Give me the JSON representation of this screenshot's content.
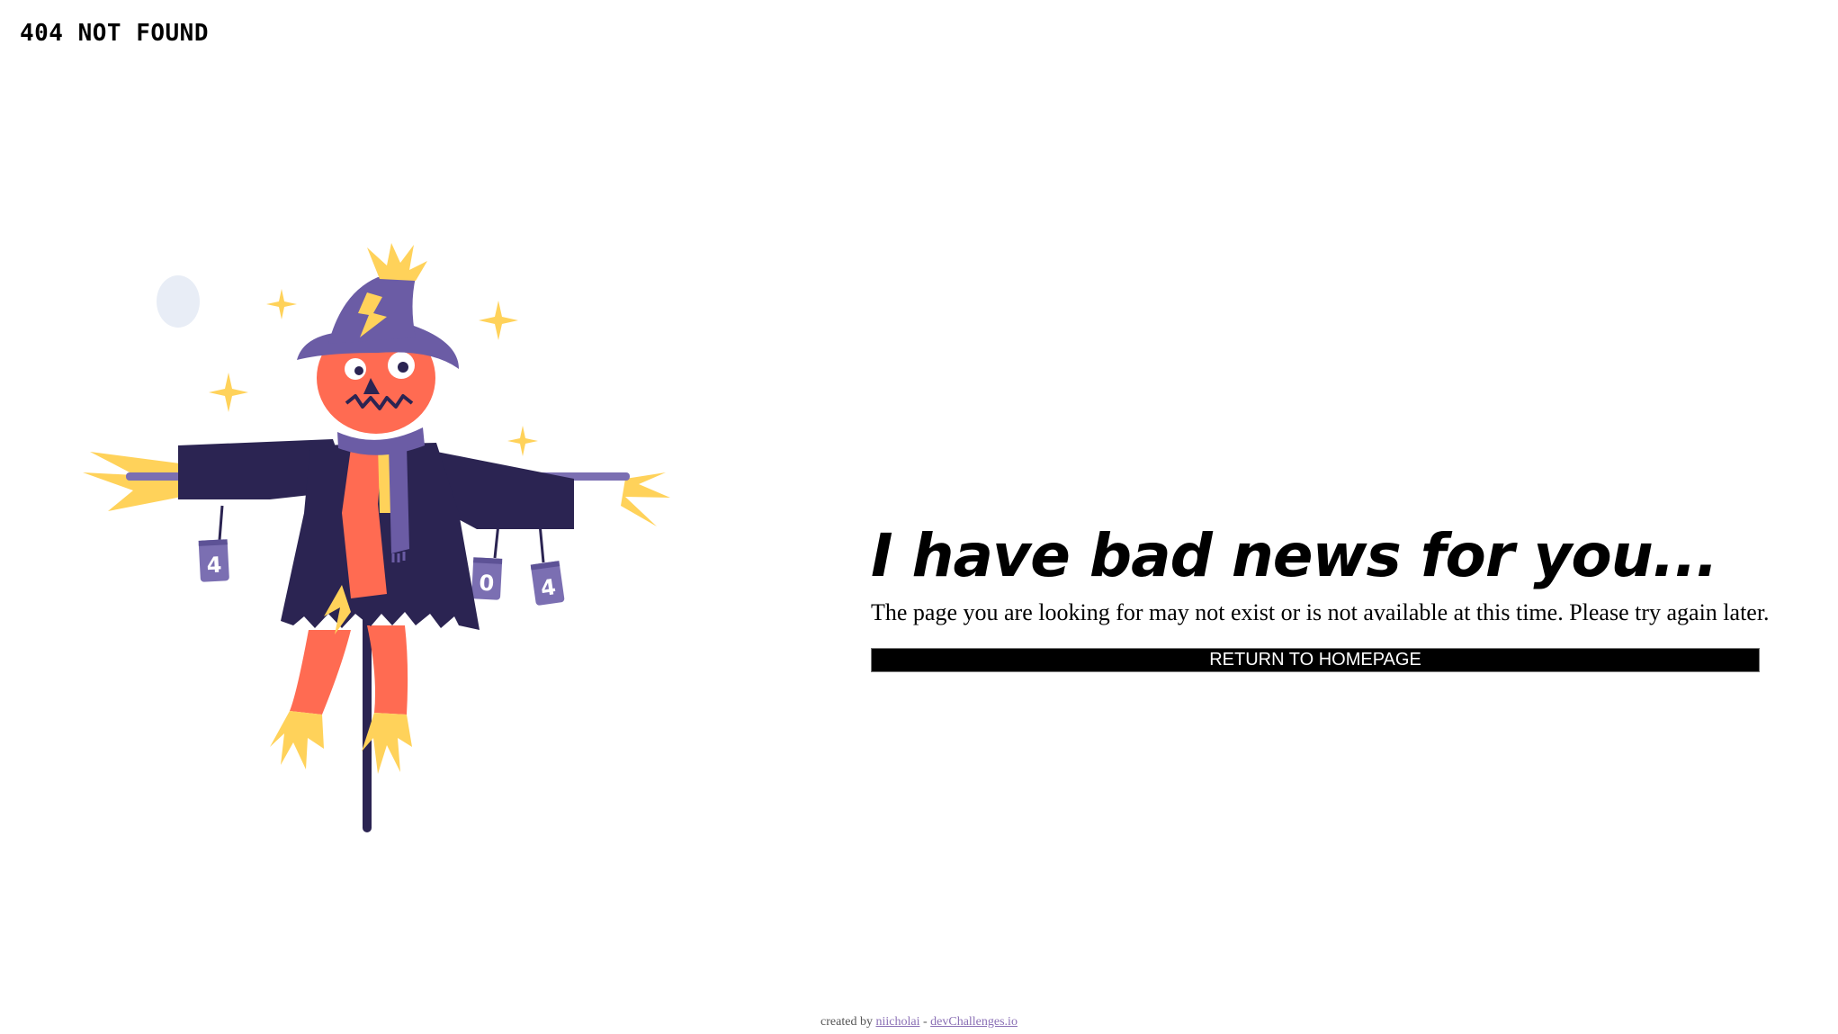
{
  "header": {
    "brand": "404 NOT FOUND"
  },
  "illustration": {
    "cans": [
      "4",
      "0",
      "4"
    ],
    "colors": {
      "coat": "#2b2452",
      "hat": "#6b5ca5",
      "pumpkin": "#ff6b52",
      "straw": "#ffd25a",
      "moon": "#e8edf6"
    }
  },
  "main": {
    "headline": "I have bad news for you...",
    "message": "The page you are looking for may not exist or is not available at this time. Please try again later.",
    "cta_label": "RETURN TO HOMEPAGE"
  },
  "footer": {
    "prefix": "created by",
    "author": "niicholai",
    "separator": "-",
    "site": "devChallenges.io"
  }
}
